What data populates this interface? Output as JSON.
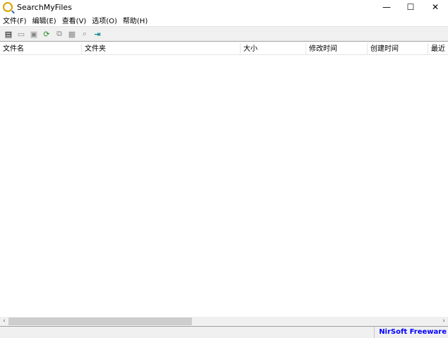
{
  "window": {
    "title": "SearchMyFiles",
    "minimize": "—",
    "maximize": "☐",
    "close": "✕"
  },
  "menu": [
    "文件(F)",
    "编辑(E)",
    "查看(V)",
    "选项(O)",
    "帮助(H)"
  ],
  "toolbar": [
    {
      "icon": "new-search-icon",
      "glyph": "▤"
    },
    {
      "icon": "open-folder-icon",
      "glyph": "▭"
    },
    {
      "icon": "save-icon",
      "glyph": "▣"
    },
    {
      "icon": "refresh-icon",
      "glyph": "⟳"
    },
    {
      "icon": "copy-icon",
      "glyph": "⧉"
    },
    {
      "icon": "properties-icon",
      "glyph": "▦"
    },
    {
      "icon": "find-icon",
      "glyph": "⌕"
    },
    {
      "icon": "exit-icon",
      "glyph": "⇥"
    }
  ],
  "columns": [
    "文件名",
    "文件夹",
    "大小",
    "修改时间",
    "创建时间",
    "最近"
  ],
  "scrollbar": {
    "left": "‹",
    "right": "›"
  },
  "status": {
    "link": "NirSoft Freeware"
  }
}
